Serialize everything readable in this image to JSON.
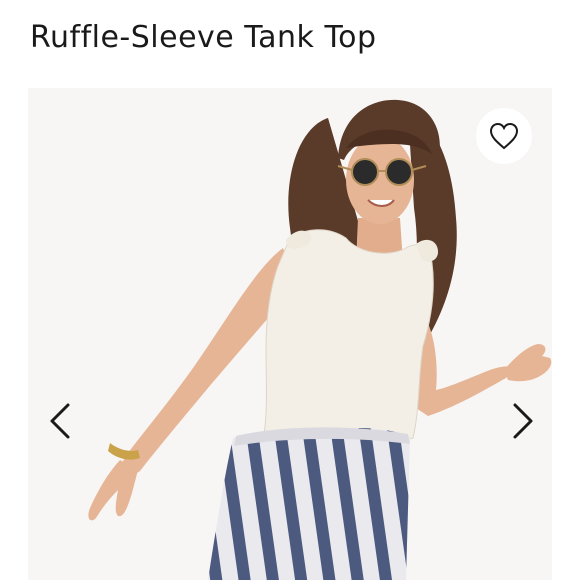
{
  "listing": {
    "title": "Ruffle-Sleeve Tank Top"
  },
  "gallery": {
    "image_alt": "Model wearing a white ruffle-sleeve tank top with blue and white striped pants and round sunglasses",
    "icons": {
      "like": "heart-outline-icon",
      "prev": "chevron-left-icon",
      "next": "chevron-right-icon"
    }
  },
  "colors": {
    "title_text": "#1a1a1a",
    "photo_background": "#f4f2f0",
    "top": "#f3efe6",
    "stripe_blue": "#4d5a80",
    "hair": "#5a3a28",
    "skin": "#e6b595"
  }
}
